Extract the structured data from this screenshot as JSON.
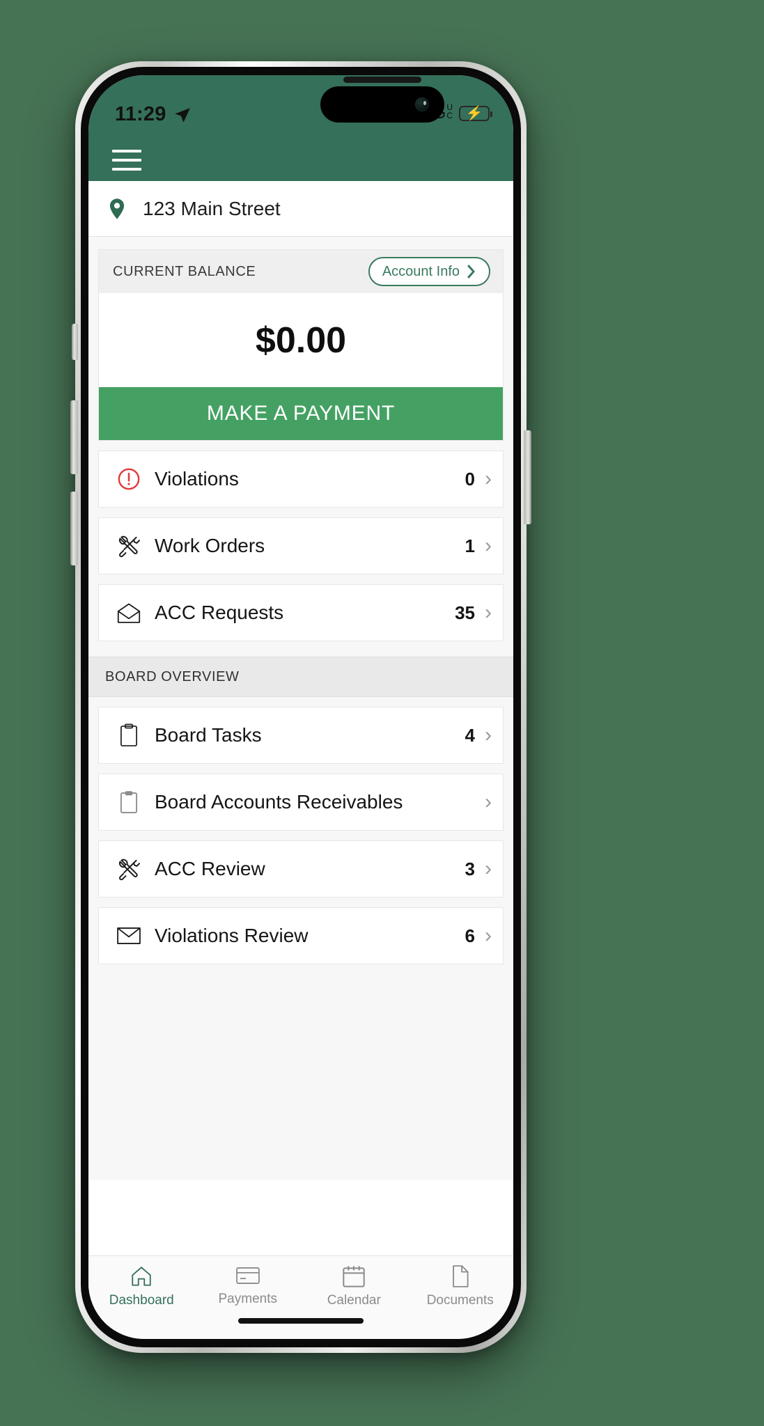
{
  "status_bar": {
    "time": "11:29",
    "location_icon": "location-arrow-icon",
    "network": "5G",
    "network_suffix_top": "U",
    "network_suffix_bottom": "C",
    "signal_icon": "cellular-bars-icon",
    "battery_icon": "battery-charging-icon"
  },
  "app_header": {
    "menu_icon": "hamburger-menu-icon",
    "brand_color": "#35705A"
  },
  "address": {
    "pin_icon": "location-pin-icon",
    "text": "123 Main Street"
  },
  "balance_card": {
    "label": "CURRENT BALANCE",
    "account_info_label": "Account Info",
    "account_info_chevron": "chevron-right-icon",
    "amount": "$0.00",
    "pay_button_label": "MAKE A PAYMENT",
    "pay_button_color": "#45a163"
  },
  "primary_rows": [
    {
      "label": "Violations",
      "count": "0",
      "icon": "alert-circle-icon"
    },
    {
      "label": "Work Orders",
      "count": "1",
      "icon": "tools-icon"
    },
    {
      "label": "ACC Requests",
      "count": "35",
      "icon": "envelope-open-icon"
    }
  ],
  "board_section": {
    "title": "BOARD OVERVIEW",
    "rows": [
      {
        "label": "Board Tasks",
        "count": "4",
        "icon": "clipboard-icon"
      },
      {
        "label": "Board Accounts Receivables",
        "count": "",
        "icon": "clipboard-filled-icon"
      },
      {
        "label": "ACC Review",
        "count": "3",
        "icon": "tools-icon"
      },
      {
        "label": "Violations Review",
        "count": "6",
        "icon": "envelope-closed-icon"
      }
    ]
  },
  "tab_bar": {
    "active_color": "#35705A",
    "tabs": [
      {
        "label": "Dashboard",
        "icon": "home-icon",
        "active": true
      },
      {
        "label": "Payments",
        "icon": "card-icon",
        "active": false
      },
      {
        "label": "Calendar",
        "icon": "calendar-icon",
        "active": false
      },
      {
        "label": "Documents",
        "icon": "document-icon",
        "active": false
      }
    ]
  }
}
